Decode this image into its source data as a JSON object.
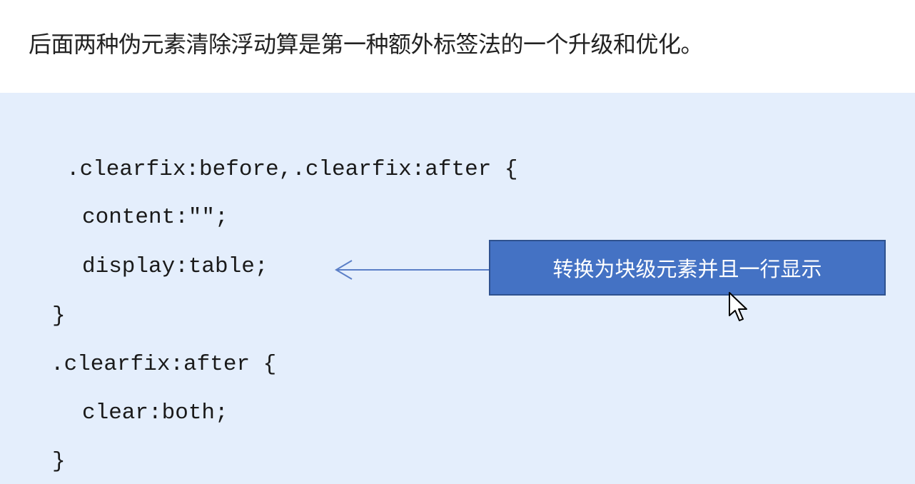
{
  "intro_text": "后面两种伪元素清除浮动算是第一种额外标签法的一个升级和优化。",
  "code_lines": [
    ".clearfix:before,.clearfix:after {",
    "content:\"\";",
    "display:table;",
    "}",
    ".clearfix:after {",
    "clear:both;",
    "}"
  ],
  "callout_text": "转换为块级元素并且一行显示",
  "colors": {
    "code_background": "#e4eefc",
    "callout_fill": "#4472c4",
    "callout_border": "#2f528f",
    "arrow": "#5b7fc7"
  },
  "icons": {
    "pointer": "mouse-pointer-icon",
    "arrow": "left-arrow-icon"
  }
}
